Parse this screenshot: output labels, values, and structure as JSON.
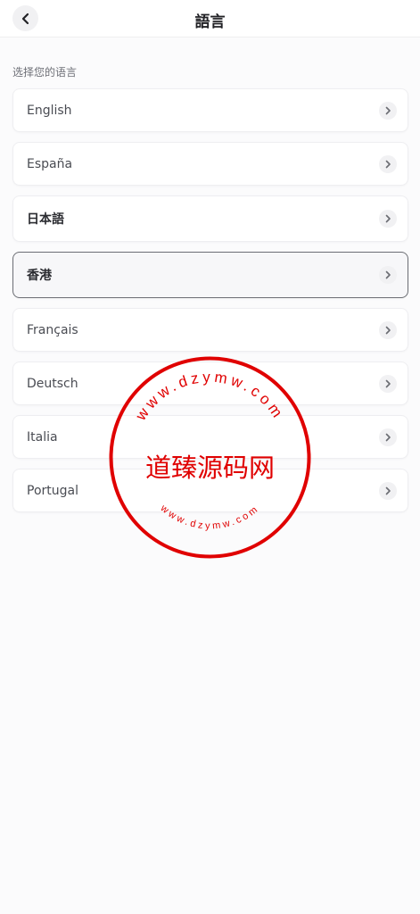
{
  "header": {
    "title": "語言",
    "back_icon": "chevron-left-icon"
  },
  "section_label": "选择您的语言",
  "languages": [
    {
      "label": "English"
    },
    {
      "label": "España"
    },
    {
      "label": "日本語"
    },
    {
      "label": "香港",
      "selected": true
    },
    {
      "label": "Français"
    },
    {
      "label": "Deutsch"
    },
    {
      "label": "Italia"
    },
    {
      "label": "Portugal"
    }
  ],
  "row_icon": "chevron-right-icon",
  "watermark": {
    "center_text": "道臻源码网",
    "ring_text": "www.dzymw.com",
    "color": "#e00000"
  },
  "colors": {
    "background": "#fbfbfc",
    "selected_border": "#6c6e74"
  }
}
